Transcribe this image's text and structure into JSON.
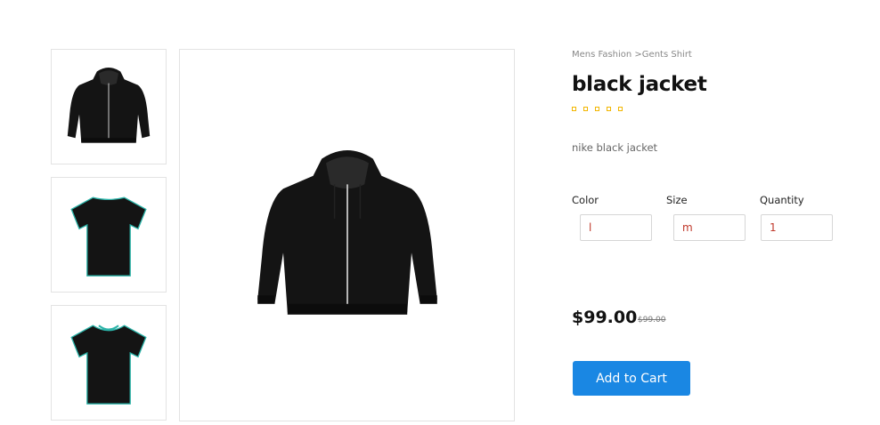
{
  "gallery": {
    "thumbnails": [
      {
        "icon": "hoodie-icon",
        "alt": "black jacket front"
      },
      {
        "icon": "tshirt-back-icon",
        "alt": "black t-shirt back"
      },
      {
        "icon": "tshirt-front-icon",
        "alt": "black t-shirt front"
      }
    ],
    "main_icon": "hoodie-icon"
  },
  "product": {
    "breadcrumb": "Mens Fashion >Gents Shirt",
    "title": "black jacket",
    "rating": {
      "value": 0,
      "max": 5,
      "color": "#f2b600"
    },
    "description": "nike black jacket",
    "options": {
      "color_label": "Color",
      "color_value": "l",
      "size_label": "Size",
      "size_value": "m",
      "quantity_label": "Quantity",
      "quantity_value": "1"
    },
    "price": "$99.00",
    "old_price": "$99.00",
    "add_to_cart_label": "Add to Cart"
  },
  "colors": {
    "accent": "#1a87e3",
    "star": "#f2b600",
    "input_text": "#c0392b",
    "garment": "#141414",
    "tshirt_trim": "#2bb3a8"
  }
}
